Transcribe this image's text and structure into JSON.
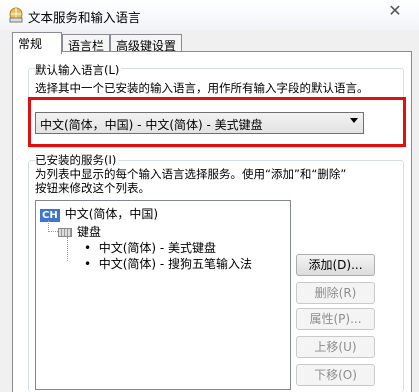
{
  "window": {
    "title": "文本服务和输入语言",
    "close_symbol": "✕",
    "icon": "globe-keyboard-icon"
  },
  "tabs": [
    {
      "label": "常规",
      "active": true
    },
    {
      "label": "语言栏",
      "active": false
    },
    {
      "label": "高级键设置",
      "active": false
    }
  ],
  "default_lang": {
    "heading": "默认输入语言(L)",
    "description": "选择其中一个已安装的输入语言，用作所有输入字段的默认语言。",
    "selected": "中文(简体，中国) - 中文(简体) - 美式键盘"
  },
  "installed": {
    "heading": "已安装的服务(I)",
    "description_line1": "为列表中显示的每个输入语言选择服务。使用“添加”和“删除”",
    "description_line2": "按钮来修改这个列表。",
    "language_badge": "CH",
    "language": "中文(简体，中国)",
    "keyboard_label": "键盘",
    "services": [
      "中文(简体) - 美式键盘",
      "中文(简体) - 搜狗五笔输入法"
    ]
  },
  "buttons": {
    "add": "添加(D)...",
    "remove": "删除(R)",
    "properties": "属性(P)...",
    "move_up": "上移(U)",
    "move_down": "下移(O)"
  },
  "colors": {
    "highlight": "#e01010",
    "lang_badge": "#3b76d1"
  }
}
